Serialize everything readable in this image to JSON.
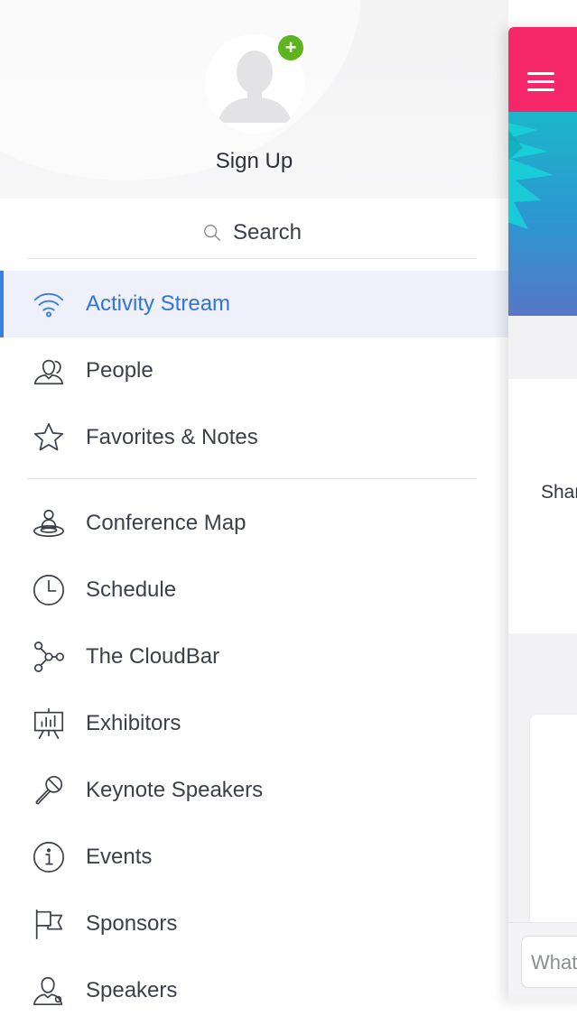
{
  "profile": {
    "signup_label": "Sign Up",
    "add_badge": "+"
  },
  "search": {
    "placeholder": "Search"
  },
  "menu": {
    "primary": [
      {
        "label": "Activity Stream",
        "icon": "wifi-icon",
        "active": true
      },
      {
        "label": "People",
        "icon": "people-icon"
      },
      {
        "label": "Favorites & Notes",
        "icon": "star-icon"
      }
    ],
    "secondary": [
      {
        "label": "Conference Map",
        "icon": "map-pin-icon"
      },
      {
        "label": "Schedule",
        "icon": "clock-icon"
      },
      {
        "label": "The CloudBar",
        "icon": "nodes-icon"
      },
      {
        "label": "Exhibitors",
        "icon": "easel-icon"
      },
      {
        "label": "Keynote Speakers",
        "icon": "microphone-icon"
      },
      {
        "label": "Events",
        "icon": "info-icon"
      },
      {
        "label": "Sponsors",
        "icon": "flag-icon"
      },
      {
        "label": "Speakers",
        "icon": "speaker-person-icon"
      }
    ]
  },
  "main": {
    "card_text": "Shar",
    "composer_placeholder": "What"
  },
  "colors": {
    "accent": "#3d7fe0",
    "topbar": "#f5276a",
    "badge": "#5fb31f"
  }
}
